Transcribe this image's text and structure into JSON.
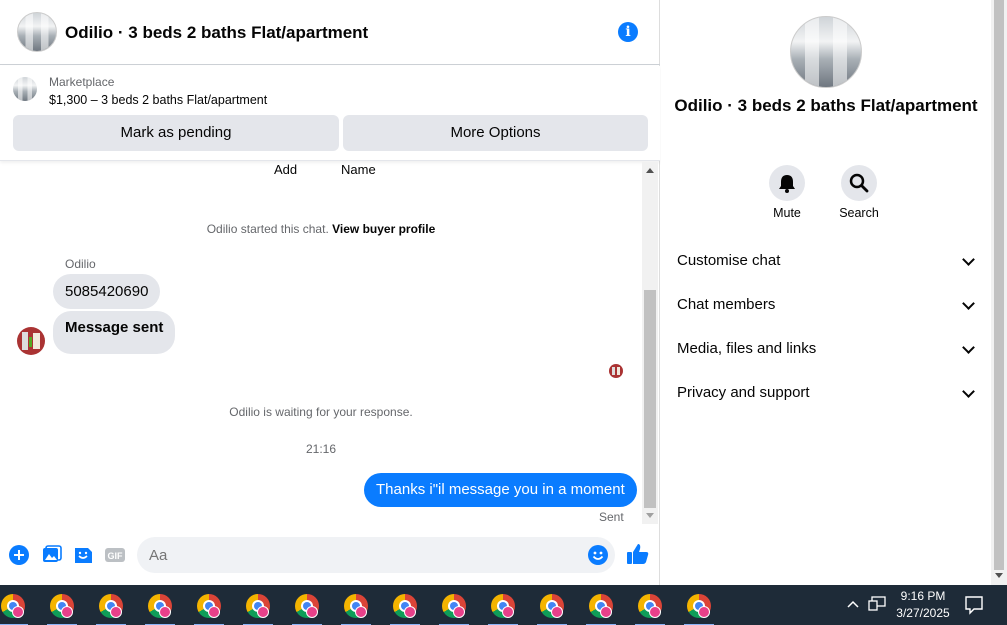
{
  "chat_header": {
    "title": "Odilio · 3 beds 2 baths Flat/apartment",
    "info_icon": "info-icon"
  },
  "listing": {
    "source": "Marketplace",
    "price_title": "$1,300 – 3 beds 2 baths Flat/apartment",
    "mark_pending": "Mark as pending",
    "more_options": "More Options"
  },
  "conversation": {
    "top_add": "Add",
    "top_name": "Name",
    "started_text": "Odilio started this chat.",
    "view_profile": "View buyer profile",
    "sender_name": "Odilio",
    "msg_phone": "5085420690",
    "msg_sent": "Message sent",
    "waiting": "Odilio is waiting for your response.",
    "timestamp": "21:16",
    "outgoing": "Thanks i\"il message you in a moment",
    "status": "Sent"
  },
  "composer": {
    "placeholder": "Aa"
  },
  "info_panel": {
    "title": "Odilio · 3 beds 2 baths Flat/apartment",
    "mute": "Mute",
    "search": "Search",
    "sections": [
      "Customise chat",
      "Chat members",
      "Media, files and links",
      "Privacy and support"
    ]
  },
  "taskbar": {
    "time": "9:16 PM",
    "date": "3/27/2025",
    "app_count": 15
  },
  "colors": {
    "accent": "#0a7cff",
    "bubble_in": "#e4e6eb",
    "taskbar": "#1e2b38"
  }
}
